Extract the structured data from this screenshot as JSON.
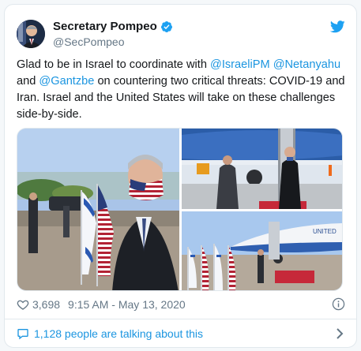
{
  "author": {
    "display_name": "Secretary Pompeo",
    "handle": "@SecPompeo",
    "verified": true
  },
  "tweet": {
    "segments": [
      {
        "text": "Glad to be in Israel to coordinate with ",
        "type": "text"
      },
      {
        "text": "@IsraeliPM",
        "type": "mention"
      },
      {
        "text": " ",
        "type": "text"
      },
      {
        "text": "@Netanyahu",
        "type": "mention"
      },
      {
        "text": " and ",
        "type": "text"
      },
      {
        "text": "@Gantzbe",
        "type": "mention"
      },
      {
        "text": " on countering two critical threats: COVID-19 and Iran. Israel and the United States will take on these challenges side-by-side.",
        "type": "text"
      }
    ]
  },
  "media": {
    "photo_count": 3,
    "plane_marking": "UNITED"
  },
  "stats": {
    "likes": "3,698",
    "timestamp": "9:15 AM - May 13, 2020"
  },
  "conversation": {
    "label": "1,128 people are talking about this"
  },
  "colors": {
    "accent": "#1b95e0",
    "twitter_blue": "#1da1f2",
    "secondary_text": "#657786",
    "border": "#e1e8ed"
  },
  "icons": [
    "twitter-bird-icon",
    "verified-badge-icon",
    "heart-icon",
    "info-icon",
    "speech-bubble-icon",
    "chevron-right-icon"
  ]
}
